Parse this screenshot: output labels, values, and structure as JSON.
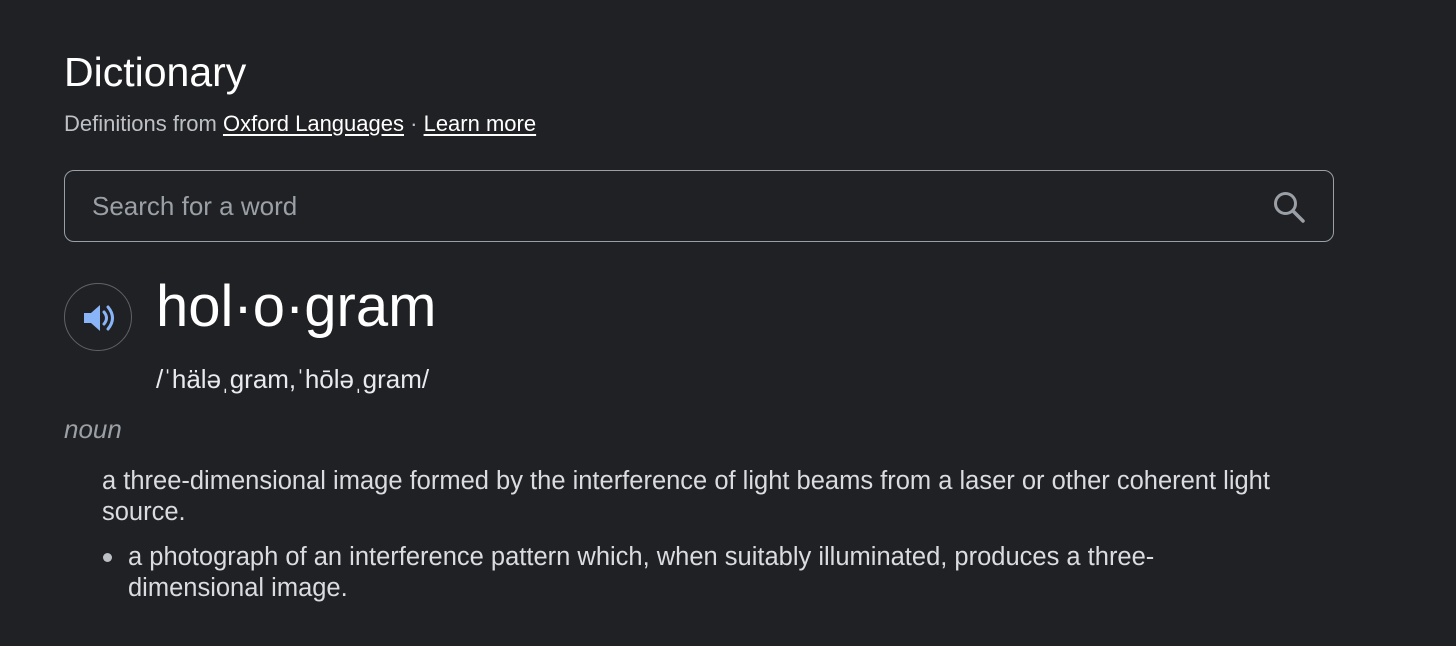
{
  "header": {
    "title": "Dictionary",
    "source_prefix": "Definitions from",
    "source_link": "Oxford Languages",
    "separator": "·",
    "learn_more": "Learn more"
  },
  "search": {
    "placeholder": "Search for a word",
    "value": "",
    "icon": "search-icon"
  },
  "entry": {
    "audio_icon": "speaker-icon",
    "headword": "hol·o·gram",
    "pronunciation": "/ˈhäləˌgram,ˈhōləˌgram/",
    "part_of_speech": "noun",
    "definition": "a three-dimensional image formed by the interference of light beams from a laser or other coherent light source.",
    "subsenses": [
      "a photograph of an interference pattern which, when suitably illuminated, produces a three-dimensional image."
    ]
  },
  "colors": {
    "background": "#202124",
    "accent": "#8ab4f8",
    "text": "#e8eaed",
    "muted": "#9aa0a6"
  }
}
